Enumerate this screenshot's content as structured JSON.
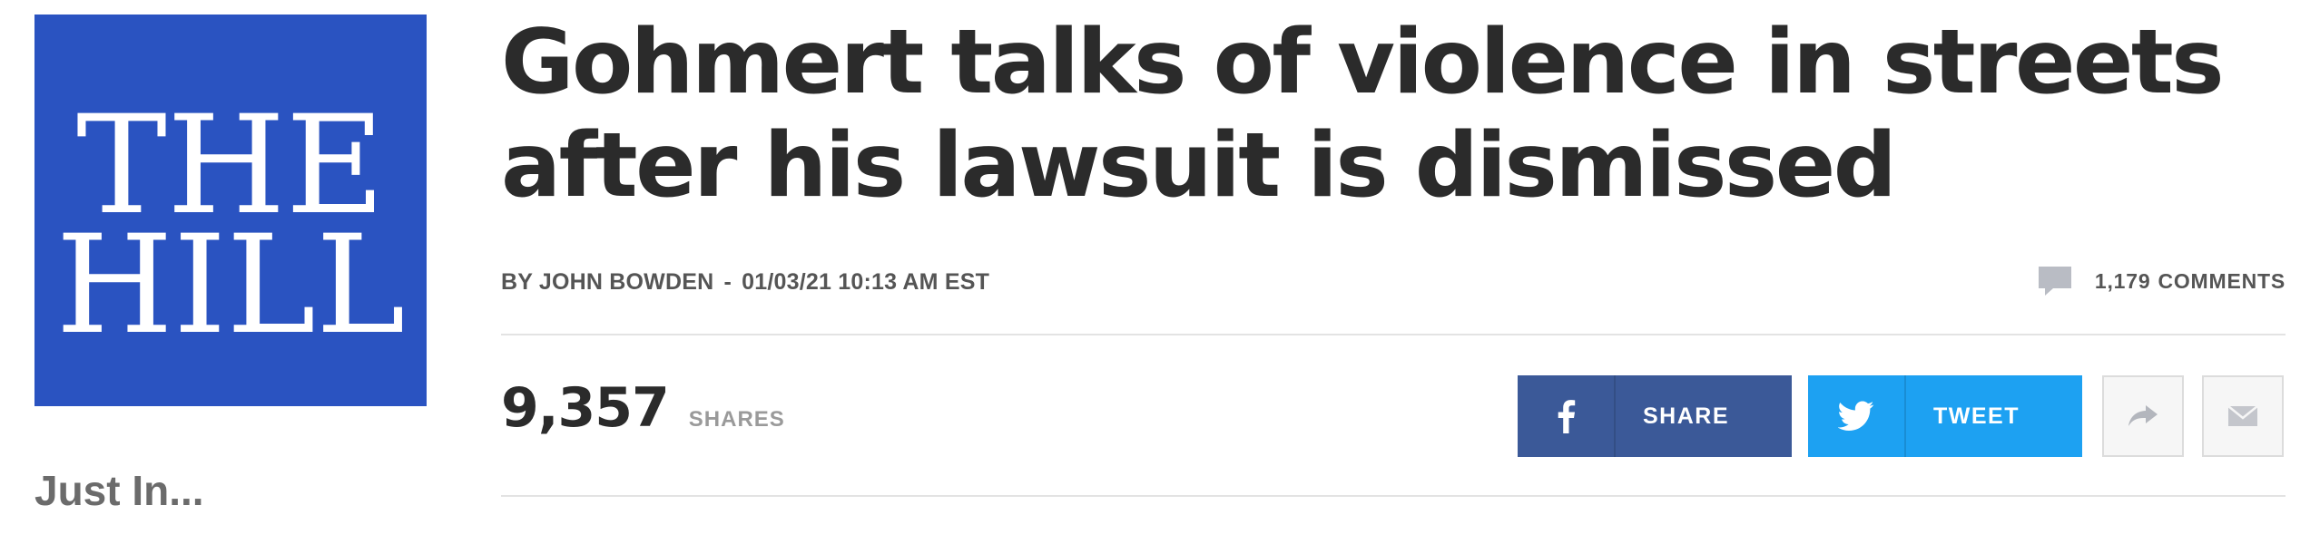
{
  "brand": {
    "logo_line1": "THE",
    "logo_line2": "HILL",
    "logo_color": "#2a53c1"
  },
  "sidebar": {
    "just_in": "Just In..."
  },
  "article": {
    "headline": "Gohmert talks of violence in streets after his lawsuit is dismissed",
    "byline": {
      "prefix": "BY",
      "author": "JOHN BOWDEN",
      "separator": "-",
      "timestamp": "01/03/21 10:13 AM EST"
    },
    "comments": {
      "count": "1,179",
      "label": "COMMENTS",
      "icon": "comment-bubble-icon"
    }
  },
  "shares": {
    "count": "9,357",
    "label": "SHARES"
  },
  "share_buttons": {
    "facebook": {
      "label": "SHARE",
      "icon": "facebook-icon",
      "color": "#3b5998"
    },
    "twitter": {
      "label": "TWEET",
      "icon": "twitter-bird-icon",
      "color": "#1da1f2"
    },
    "forward": {
      "icon": "forward-arrow-icon"
    },
    "email": {
      "icon": "envelope-icon"
    }
  }
}
